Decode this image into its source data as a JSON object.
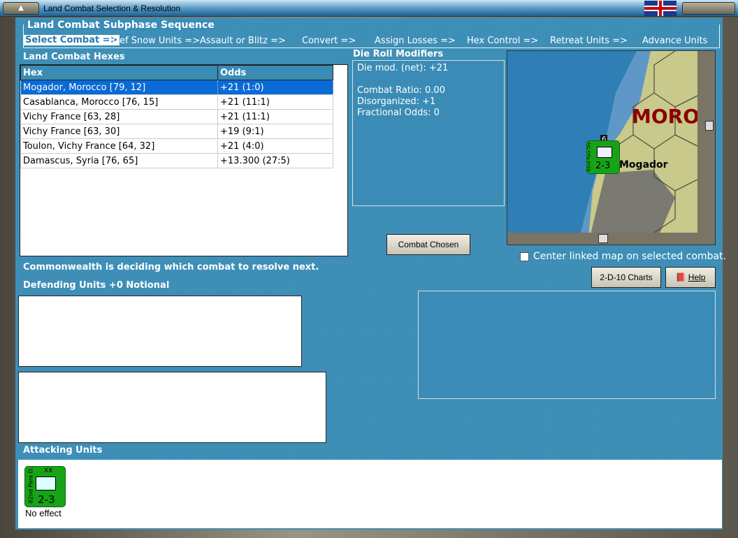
{
  "window": {
    "title": "Land Combat Selection & Resolution",
    "flag": "uk-flag"
  },
  "subphase": {
    "title": "Land Combat Subphase Sequence",
    "steps": [
      "Select Combat =>",
      "Def Snow Units =>",
      "Assault or Blitz =>",
      "Convert =>",
      "Assign Losses =>",
      "Hex Control =>",
      "Retreat Units =>",
      "Advance Units"
    ],
    "active": 0
  },
  "hexes": {
    "title": "Land Combat Hexes",
    "columns": [
      "Hex",
      "Odds"
    ],
    "rows": [
      {
        "hex": "Mogador, Morocco [79, 12]",
        "odds": "+21 (1:0)",
        "selected": true
      },
      {
        "hex": "Casablanca, Morocco [76, 15]",
        "odds": "+21 (11:1)"
      },
      {
        "hex": "Vichy France [63, 28]",
        "odds": "+21 (11:1)"
      },
      {
        "hex": "Vichy France [63, 30]",
        "odds": "+19 (9:1)"
      },
      {
        "hex": "Toulon, Vichy France [64, 32]",
        "odds": "+21 (4:0)"
      },
      {
        "hex": "Damascus, Syria [76, 65]",
        "odds": "+13.300 (27:5)"
      }
    ]
  },
  "modifiers": {
    "title": "Die Roll Modifiers",
    "lines": [
      "Die mod. (net): +21",
      "",
      "Combat Ratio: 0.00",
      "Disorganized: +1",
      "Fractional Odds: 0"
    ]
  },
  "map": {
    "country_label": "MOROCCO",
    "city_label": "Mogador",
    "unit": {
      "name": "82nd Para Div",
      "strength": "2-3",
      "stack": "6",
      "size": "XX"
    }
  },
  "buttons": {
    "combat_chosen": "Combat Chosen",
    "charts": "2-D-10 Charts",
    "help": "Help"
  },
  "center_checkbox": {
    "label": "Center linked map on selected combat.",
    "checked": false
  },
  "status": "Commonwealth is deciding which combat to resolve next.",
  "defending": {
    "title": "Defending Units +0 Notional"
  },
  "attacking": {
    "title": "Attacking Units",
    "units": [
      {
        "name": "82nd Para D.",
        "size": "XX",
        "strength": "2-3",
        "result": "No effect"
      }
    ]
  },
  "colors": {
    "panel": "#3a8cb6",
    "selection": "#0a6ad6",
    "unit": "#17a317",
    "country": "#8b0000"
  }
}
